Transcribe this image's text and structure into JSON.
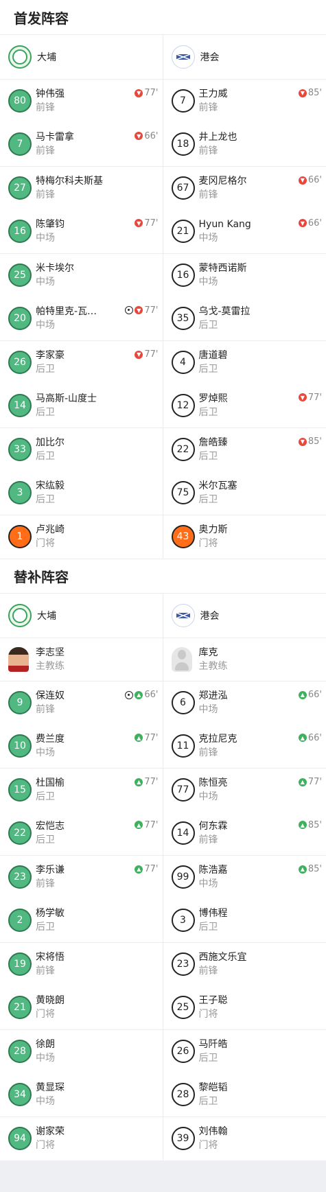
{
  "starting": {
    "title": "首发阵容",
    "home": {
      "name": "大埔"
    },
    "away": {
      "name": "港会"
    },
    "rows": [
      {
        "home": {
          "num": "80",
          "name": "钟伟强",
          "pos": "前锋",
          "events": [
            {
              "type": "out",
              "min": "77'"
            }
          ]
        },
        "away": {
          "num": "7",
          "name": "王力威",
          "pos": "前锋",
          "events": [
            {
              "type": "out",
              "min": "85'"
            }
          ]
        }
      },
      {
        "home": {
          "num": "7",
          "name": "马卡雷拿",
          "pos": "前锋",
          "events": [
            {
              "type": "out",
              "min": "66'"
            }
          ]
        },
        "away": {
          "num": "18",
          "name": "井上龙也",
          "pos": "前锋",
          "events": []
        }
      },
      {
        "home": {
          "num": "27",
          "name": "特梅尔科夫斯基",
          "pos": "前锋",
          "events": []
        },
        "away": {
          "num": "67",
          "name": "麦冈尼格尔",
          "pos": "前锋",
          "events": [
            {
              "type": "out",
              "min": "66'"
            }
          ]
        }
      },
      {
        "home": {
          "num": "16",
          "name": "陈肇钧",
          "pos": "中场",
          "events": [
            {
              "type": "out",
              "min": "77'"
            }
          ]
        },
        "away": {
          "num": "21",
          "name": "Hyun Kang",
          "pos": "中场",
          "events": [
            {
              "type": "out",
              "min": "66'"
            }
          ]
        }
      },
      {
        "home": {
          "num": "25",
          "name": "米卡埃尔",
          "pos": "中场",
          "events": []
        },
        "away": {
          "num": "16",
          "name": "蒙特西诺斯",
          "pos": "中场",
          "events": []
        }
      },
      {
        "home": {
          "num": "20",
          "name": "帕特里克-瓦…",
          "pos": "中场",
          "events": [
            {
              "type": "goal"
            },
            {
              "type": "out",
              "min": "77'"
            }
          ]
        },
        "away": {
          "num": "35",
          "name": "乌戈-莫雷拉",
          "pos": "后卫",
          "events": []
        }
      },
      {
        "home": {
          "num": "26",
          "name": "李家豪",
          "pos": "后卫",
          "events": [
            {
              "type": "out",
              "min": "77'"
            }
          ]
        },
        "away": {
          "num": "4",
          "name": "唐道碧",
          "pos": "后卫",
          "events": []
        }
      },
      {
        "home": {
          "num": "14",
          "name": "马高斯-山度士",
          "pos": "后卫",
          "events": []
        },
        "away": {
          "num": "12",
          "name": "罗焯熙",
          "pos": "后卫",
          "events": [
            {
              "type": "out",
              "min": "77'"
            }
          ]
        }
      },
      {
        "home": {
          "num": "33",
          "name": "加比尔",
          "pos": "后卫",
          "events": []
        },
        "away": {
          "num": "22",
          "name": "詹皓臻",
          "pos": "后卫",
          "events": [
            {
              "type": "out",
              "min": "85'"
            }
          ]
        }
      },
      {
        "home": {
          "num": "3",
          "name": "宋纮毅",
          "pos": "后卫",
          "events": []
        },
        "away": {
          "num": "75",
          "name": "米尔瓦塞",
          "pos": "后卫",
          "events": []
        }
      },
      {
        "home": {
          "num": "1",
          "name": "卢兆崎",
          "pos": "门将",
          "gk": true,
          "events": []
        },
        "away": {
          "num": "43",
          "name": "奥力斯",
          "pos": "门将",
          "gk": true,
          "events": []
        }
      }
    ]
  },
  "subs": {
    "title": "替补阵容",
    "home": {
      "name": "大埔",
      "coach": {
        "name": "李志坚",
        "role": "主教练"
      }
    },
    "away": {
      "name": "港会",
      "coach": {
        "name": "库克",
        "role": "主教练"
      }
    },
    "rows": [
      {
        "home": {
          "num": "9",
          "name": "保连奴",
          "pos": "前锋",
          "events": [
            {
              "type": "goal"
            },
            {
              "type": "in",
              "min": "66'"
            }
          ]
        },
        "away": {
          "num": "6",
          "name": "郑进泓",
          "pos": "中场",
          "events": [
            {
              "type": "in",
              "min": "66'"
            }
          ]
        }
      },
      {
        "home": {
          "num": "10",
          "name": "费兰度",
          "pos": "中场",
          "events": [
            {
              "type": "in",
              "min": "77'"
            }
          ]
        },
        "away": {
          "num": "11",
          "name": "克拉尼克",
          "pos": "前锋",
          "events": [
            {
              "type": "in",
              "min": "66'"
            }
          ]
        }
      },
      {
        "home": {
          "num": "15",
          "name": "杜国榆",
          "pos": "后卫",
          "events": [
            {
              "type": "in",
              "min": "77'"
            }
          ]
        },
        "away": {
          "num": "77",
          "name": "陈恒亮",
          "pos": "中场",
          "events": [
            {
              "type": "in",
              "min": "77'"
            }
          ]
        }
      },
      {
        "home": {
          "num": "22",
          "name": "宏恺志",
          "pos": "后卫",
          "events": [
            {
              "type": "in",
              "min": "77'"
            }
          ]
        },
        "away": {
          "num": "14",
          "name": "何东霖",
          "pos": "前锋",
          "events": [
            {
              "type": "in",
              "min": "85'"
            }
          ]
        }
      },
      {
        "home": {
          "num": "23",
          "name": "李乐谦",
          "pos": "前锋",
          "events": [
            {
              "type": "in",
              "min": "77'"
            }
          ]
        },
        "away": {
          "num": "99",
          "name": "陈浩嘉",
          "pos": "中场",
          "events": [
            {
              "type": "in",
              "min": "85'"
            }
          ]
        }
      },
      {
        "home": {
          "num": "2",
          "name": "杨学敏",
          "pos": "后卫",
          "events": []
        },
        "away": {
          "num": "3",
          "name": "博伟程",
          "pos": "后卫",
          "events": []
        }
      },
      {
        "home": {
          "num": "19",
          "name": "宋将悟",
          "pos": "前锋",
          "events": []
        },
        "away": {
          "num": "23",
          "name": "西施文乐宜",
          "pos": "前锋",
          "events": []
        }
      },
      {
        "home": {
          "num": "21",
          "name": "黄晓朗",
          "pos": "门将",
          "events": []
        },
        "away": {
          "num": "25",
          "name": "王子聪",
          "pos": "门将",
          "events": []
        }
      },
      {
        "home": {
          "num": "28",
          "name": "徐朗",
          "pos": "中场",
          "events": []
        },
        "away": {
          "num": "26",
          "name": "马阡皓",
          "pos": "后卫",
          "events": []
        }
      },
      {
        "home": {
          "num": "34",
          "name": "黄显琛",
          "pos": "中场",
          "events": []
        },
        "away": {
          "num": "28",
          "name": "黎皑韬",
          "pos": "后卫",
          "events": []
        }
      },
      {
        "home": {
          "num": "94",
          "name": "谢家荣",
          "pos": "门将",
          "events": []
        },
        "away": {
          "num": "39",
          "name": "刘伟翰",
          "pos": "门将",
          "events": []
        }
      }
    ]
  }
}
